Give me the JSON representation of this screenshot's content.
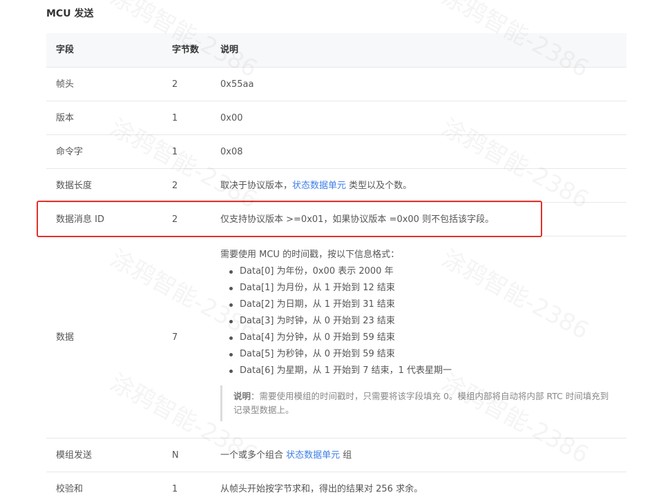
{
  "section_title": "MCU 发送",
  "table": {
    "headers": [
      "字段",
      "字节数",
      "说明"
    ],
    "rows": [
      {
        "field": "帧头",
        "bytes": "2",
        "desc": "0x55aa"
      },
      {
        "field": "版本",
        "bytes": "1",
        "desc": "0x00"
      },
      {
        "field": "命令字",
        "bytes": "1",
        "desc": "0x08"
      },
      {
        "field": "数据长度",
        "bytes": "2",
        "desc_prefix": "取决于协议版本，",
        "desc_link": "状态数据单元",
        "desc_suffix": " 类型以及个数。"
      },
      {
        "field": "数据消息 ID",
        "bytes": "2",
        "desc": "仅支持协议版本 >=0x01，如果协议版本 =0x00 则不包括该字段。"
      }
    ],
    "data_row": {
      "field": "数据",
      "bytes": "7",
      "intro": "需要使用 MCU 的时间戳，按以下信息格式：",
      "bullets": [
        "Data[0] 为年份，0x00 表示 2000 年",
        "Data[1] 为月份，从 1 开始到 12 结束",
        "Data[2] 为日期，从 1 开始到 31 结束",
        "Data[3] 为时钟，从 0 开始到 23 结束",
        "Data[4] 为分钟，从 0 开始到 59 结束",
        "Data[5] 为秒钟，从 0 开始到 59 结束",
        "Data[6] 为星期，从 1 开始到 7 结束，1 代表星期一"
      ],
      "note_label": "说明",
      "note_text": "：需要使用模组的时间戳时，只需要将该字段填充 0。模组内部将自动将内部 RTC 时间填充到记录型数据上。"
    },
    "tail_rows": [
      {
        "field": "模组发送",
        "bytes": "N",
        "desc_prefix": "一个或多个组合 ",
        "desc_link": "状态数据单元",
        "desc_suffix": " 组"
      },
      {
        "field": "校验和",
        "bytes": "1",
        "desc": "从帧头开始按字节求和，得出的结果对 256 求余。"
      }
    ]
  },
  "watermark_text": "涂鸦智能-2386",
  "colors": {
    "link": "#3d7fe8",
    "highlight": "#e0302a",
    "header_bg": "#f7f8fa"
  }
}
